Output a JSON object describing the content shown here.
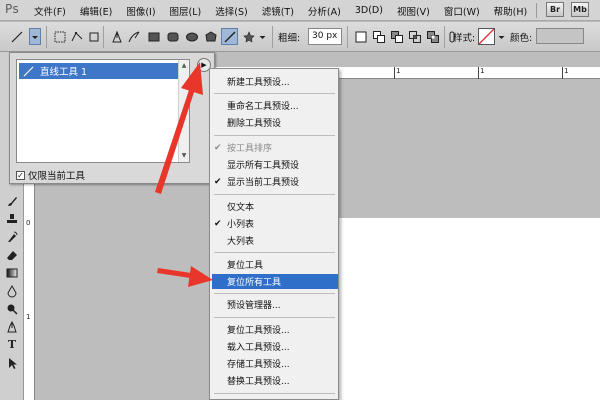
{
  "app": {
    "logo": "Ps"
  },
  "menubar": {
    "items": [
      "文件(F)",
      "编辑(E)",
      "图像(I)",
      "图层(L)",
      "选择(S)",
      "滤镜(T)",
      "分析(A)",
      "3D(D)",
      "视图(V)",
      "窗口(W)",
      "帮助(H)"
    ],
    "right_buttons": [
      "Br",
      "Mb"
    ]
  },
  "options_bar": {
    "weight_label": "粗细:",
    "weight_value": "30 px",
    "style_label": "样式:",
    "color_label": "颜色:",
    "color_value": "#c4c4c4"
  },
  "preset_panel": {
    "selected_preset": "直线工具 1",
    "only_current_label": "仅限当前工具",
    "only_current_checked": "☑"
  },
  "ruler": {
    "top_labels": [
      "1",
      "1",
      "1"
    ],
    "left_labels": [
      "0",
      "1"
    ]
  },
  "flyout_menu": {
    "items": [
      {
        "label": "新建工具预设..."
      },
      {
        "label": "重命名工具预设..."
      },
      {
        "label": "删除工具预设"
      },
      {
        "label": "按工具排序",
        "check": "✔",
        "disabled": true
      },
      {
        "label": "显示所有工具预设"
      },
      {
        "label": "显示当前工具预设",
        "check": "✔"
      },
      {
        "label": "仅文本"
      },
      {
        "label": "小列表",
        "check": "✔"
      },
      {
        "label": "大列表"
      },
      {
        "label": "复位工具"
      },
      {
        "label": "复位所有工具",
        "highlight": true
      },
      {
        "label": "预设管理器..."
      },
      {
        "label": "复位工具预设..."
      },
      {
        "label": "载入工具预设..."
      },
      {
        "label": "存储工具预设..."
      },
      {
        "label": "替换工具预设..."
      }
    ]
  },
  "colors": {
    "highlight": "#2f6fc9",
    "annotation_arrow": "#e8362a"
  }
}
